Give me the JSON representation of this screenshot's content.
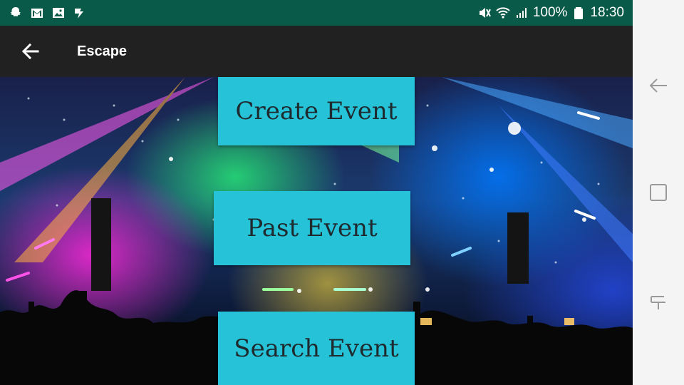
{
  "status_bar": {
    "icons_left": [
      "snapchat-icon",
      "gmail-icon",
      "gallery-icon",
      "tasks-icon"
    ],
    "icons_right": [
      "mute-icon",
      "wifi-icon",
      "signal-icon",
      "battery-icon"
    ],
    "battery": "100%",
    "time": "18:30",
    "bg_color": "#0a5a4a"
  },
  "app_bar": {
    "title": "Escape",
    "back_icon": "arrow-back-icon",
    "bg_color": "#212121"
  },
  "main": {
    "background_image": "concert-crowd-lights",
    "buttons": [
      {
        "label": "Create Event"
      },
      {
        "label": "Past Event"
      },
      {
        "label": "Search Event"
      }
    ],
    "button_color": "#26c2d7"
  },
  "nav_bar": {
    "icons": [
      "nav-back-icon",
      "nav-home-icon",
      "nav-recent-icon"
    ]
  }
}
